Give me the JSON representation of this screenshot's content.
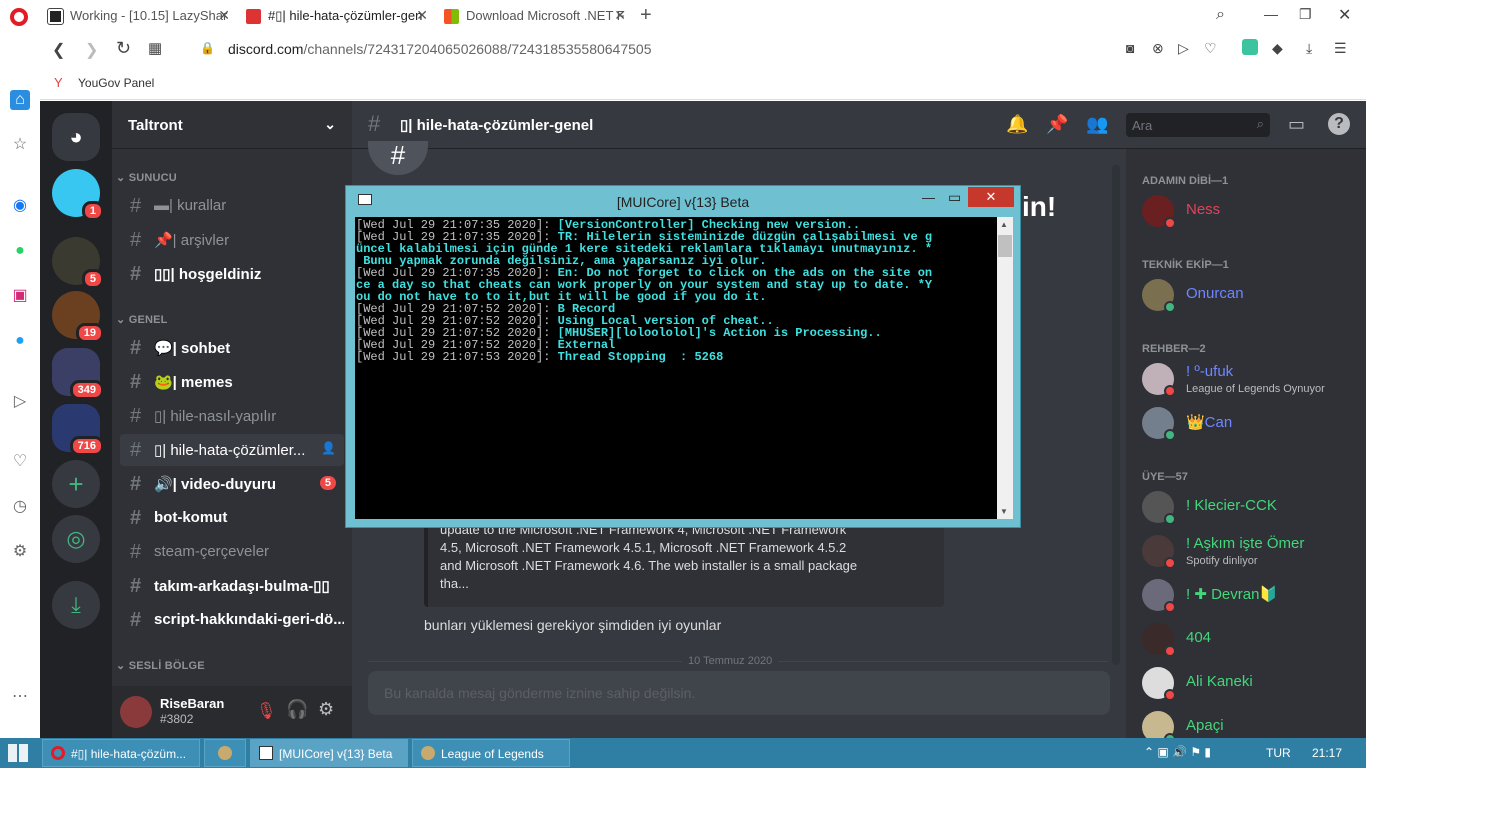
{
  "browser": {
    "tabs": [
      {
        "label": "Working - [10.15] LazyShar"
      },
      {
        "label": "#▯| hile-hata-çözümler-gen"
      },
      {
        "label": "Download Microsoft .NET F"
      }
    ],
    "new_tab": "+",
    "url_domain": "discord.com",
    "url_path": "/channels/724317204065026088/724318535580647505",
    "bookmark": "YouGov Panel"
  },
  "discord": {
    "server_name": "Taltront",
    "guild_badges": [
      "1",
      "5",
      "19",
      "349",
      "716"
    ],
    "categories": {
      "sunucu": "SUNUCU",
      "genel": "GENEL",
      "sesli": "SESLİ BÖLGE"
    },
    "channels": [
      {
        "name": "▬| kurallar"
      },
      {
        "name": "📌| arşivler"
      },
      {
        "name": "▯▯| hoşgeldiniz"
      },
      {
        "name": "💬| sohbet"
      },
      {
        "name": "🐸| memes"
      },
      {
        "name": "▯| hile-nasıl-yapılır"
      },
      {
        "name": "▯| hile-hata-çözümler..."
      },
      {
        "name": "🔊| video-duyuru",
        "badge": "5"
      },
      {
        "name": "bot-komut"
      },
      {
        "name": "steam-çerçeveler"
      },
      {
        "name": "takım-arkadaşı-bulma-▯▯"
      },
      {
        "name": "script-hakkındaki-geri-dö..."
      }
    ],
    "user": {
      "name": "RiseBaran",
      "tag": "#3802"
    },
    "chat_header": "▯| hile-hata-çözümler-genel",
    "search_placeholder": "Ara",
    "welcome_tail": "in!",
    "embed_text": "update to the Microsoft .NET Framework 4, Microsoft .NET Framework 4.5, Microsoft .NET Framework 4.5.1, Microsoft .NET Framework 4.5.2 and Microsoft .NET Framework 4.6. The web installer is a small package tha...",
    "message": "bunları yüklemesi gerekiyor şimdiden iyi oyunlar",
    "date_divider": "10 Temmuz 2020",
    "composer_placeholder": "Bu kanalda mesaj gönderme iznine sahip değilsin.",
    "member_groups": [
      {
        "label": "ADAMIN DİBİ—1"
      },
      {
        "label": "TEKNİK EKİP—1"
      },
      {
        "label": "REHBER—2"
      },
      {
        "label": "ÜYE—57"
      }
    ],
    "members": [
      {
        "name": "Ness",
        "color": "#e0445a"
      },
      {
        "name": "Onurcan",
        "color": "#6f86ff"
      },
      {
        "name": "! º-ufuk",
        "color": "#6f86ff",
        "activity": "League of Legends Oynuyor"
      },
      {
        "name": "👑Can",
        "color": "#6f86ff"
      },
      {
        "name": "! Klecier-CCK",
        "color": "#43d67a"
      },
      {
        "name": "! Aşkım işte Ömer",
        "color": "#43d67a",
        "activity": "Spotify dinliyor"
      },
      {
        "name": "! ✚ Devran🔰",
        "color": "#43d67a"
      },
      {
        "name": "404",
        "color": "#43d67a"
      },
      {
        "name": "Ali Kaneki",
        "color": "#43d67a"
      },
      {
        "name": "Apaçi",
        "color": "#43d67a"
      }
    ]
  },
  "console": {
    "title": "[MUICore] v{13} Beta",
    "lines": [
      {
        "ts": "[Wed Jul 29 21:07:35 2020]: ",
        "text": "[VersionController] Checking new version.."
      },
      {
        "ts": "[Wed Jul 29 21:07:35 2020]: ",
        "text": "TR: Hilelerin sisteminizde düzgün çalışabilmesi ve g"
      },
      {
        "ts": "",
        "text": "üncel kalabilmesi için günde 1 kere sitedeki reklamlara tıklamayı unutmayınız. *"
      },
      {
        "ts": "",
        "text": " Bunu yapmak zorunda değilsiniz, ama yaparsanız iyi olur."
      },
      {
        "ts": "[Wed Jul 29 21:07:35 2020]: ",
        "text": "En: Do not forget to click on the ads on the site on"
      },
      {
        "ts": "",
        "text": "ce a day so that cheats can work properly on your system and stay up to date. *Y"
      },
      {
        "ts": "",
        "text": "ou do not have to to it,but it will be good if you do it."
      },
      {
        "ts": "[Wed Jul 29 21:07:52 2020]: ",
        "text": "B Record"
      },
      {
        "ts": "[Wed Jul 29 21:07:52 2020]: ",
        "text": "Using Local version of cheat.."
      },
      {
        "ts": "[Wed Jul 29 21:07:52 2020]: ",
        "text": "[MHUSER][loloololol]'s Action is Processing.."
      },
      {
        "ts": "[Wed Jul 29 21:07:52 2020]: ",
        "text": "External"
      },
      {
        "ts": "[Wed Jul 29 21:07:53 2020]: ",
        "text": "Thread Stopping  : 5268"
      }
    ]
  },
  "taskbar": {
    "items": [
      "#▯| hile-hata-çözüm...",
      "[MUICore] v{13} Beta",
      "League of Legends"
    ],
    "lang": "TUR",
    "time": "21:17"
  }
}
